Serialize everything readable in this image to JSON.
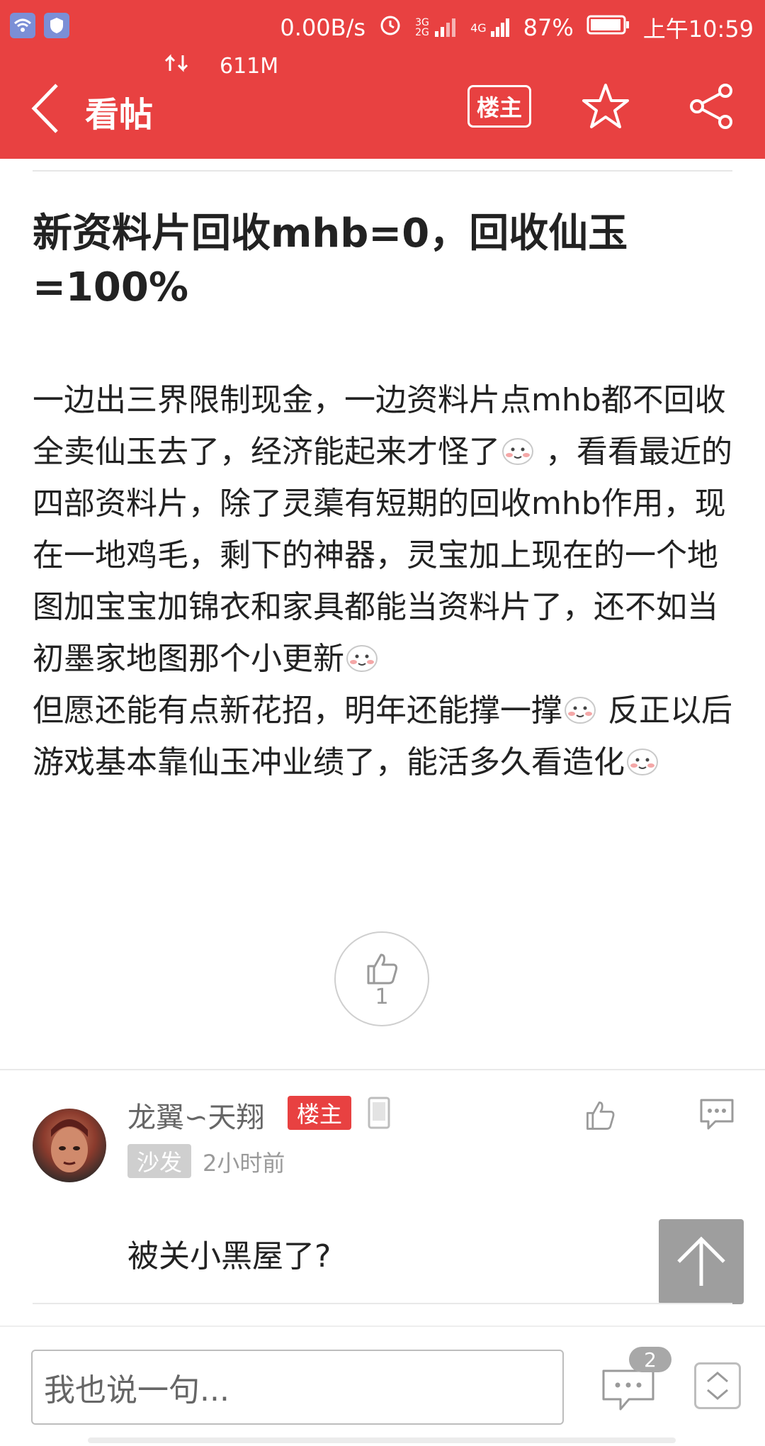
{
  "status_bar": {
    "net_speed": "0.00B/s",
    "battery": "87%",
    "time": "上午10:59",
    "data_usage": "611M",
    "signal_a_label": "3G 2G",
    "signal_b_label": "4G"
  },
  "nav": {
    "title": "看帖",
    "owner_only_label": "楼主"
  },
  "post": {
    "title": "新资料片回收mhb=0，回收仙玉=100%",
    "body_segments": {
      "s1": "一边出三界限制现金，一边资料片点mhb都不回收全卖仙玉去了，经济能起来才怪了",
      "s2": " ，看看最近的四部资料片，除了灵蕖有短期的回收mhb作用，现在一地鸡毛，剩下的神器，灵宝加上现在的一个地图加宝宝加锦衣和家具都能当资料片了，还不如当初墨家地图那个小更新",
      "s3": "但愿还能有点新花招，明年还能撑一撑",
      "s4": " 反正以后游戏基本靠仙玉冲业绩了，能活多久看造化"
    },
    "like_count": "1"
  },
  "comment": {
    "username": "龙翼∽天翔",
    "owner_badge": "楼主",
    "floor": "沙发",
    "time": "2小时前",
    "text": "被关小黑屋了?"
  },
  "bottom_bar": {
    "input_placeholder": "我也说一句...",
    "comments_count": "2"
  },
  "colors": {
    "brand_red": "#e84141",
    "muted_gray": "#9a9a9a"
  },
  "icons": [
    "wifi-icon",
    "shield-icon",
    "alarm-icon",
    "battery-icon",
    "sync-icon",
    "back-icon",
    "star-icon",
    "share-icon",
    "thumbs-up-icon",
    "phone-device-icon",
    "reply-icon",
    "arrow-up-icon",
    "comments-icon",
    "page-nav-icon",
    "emoji-icon"
  ]
}
